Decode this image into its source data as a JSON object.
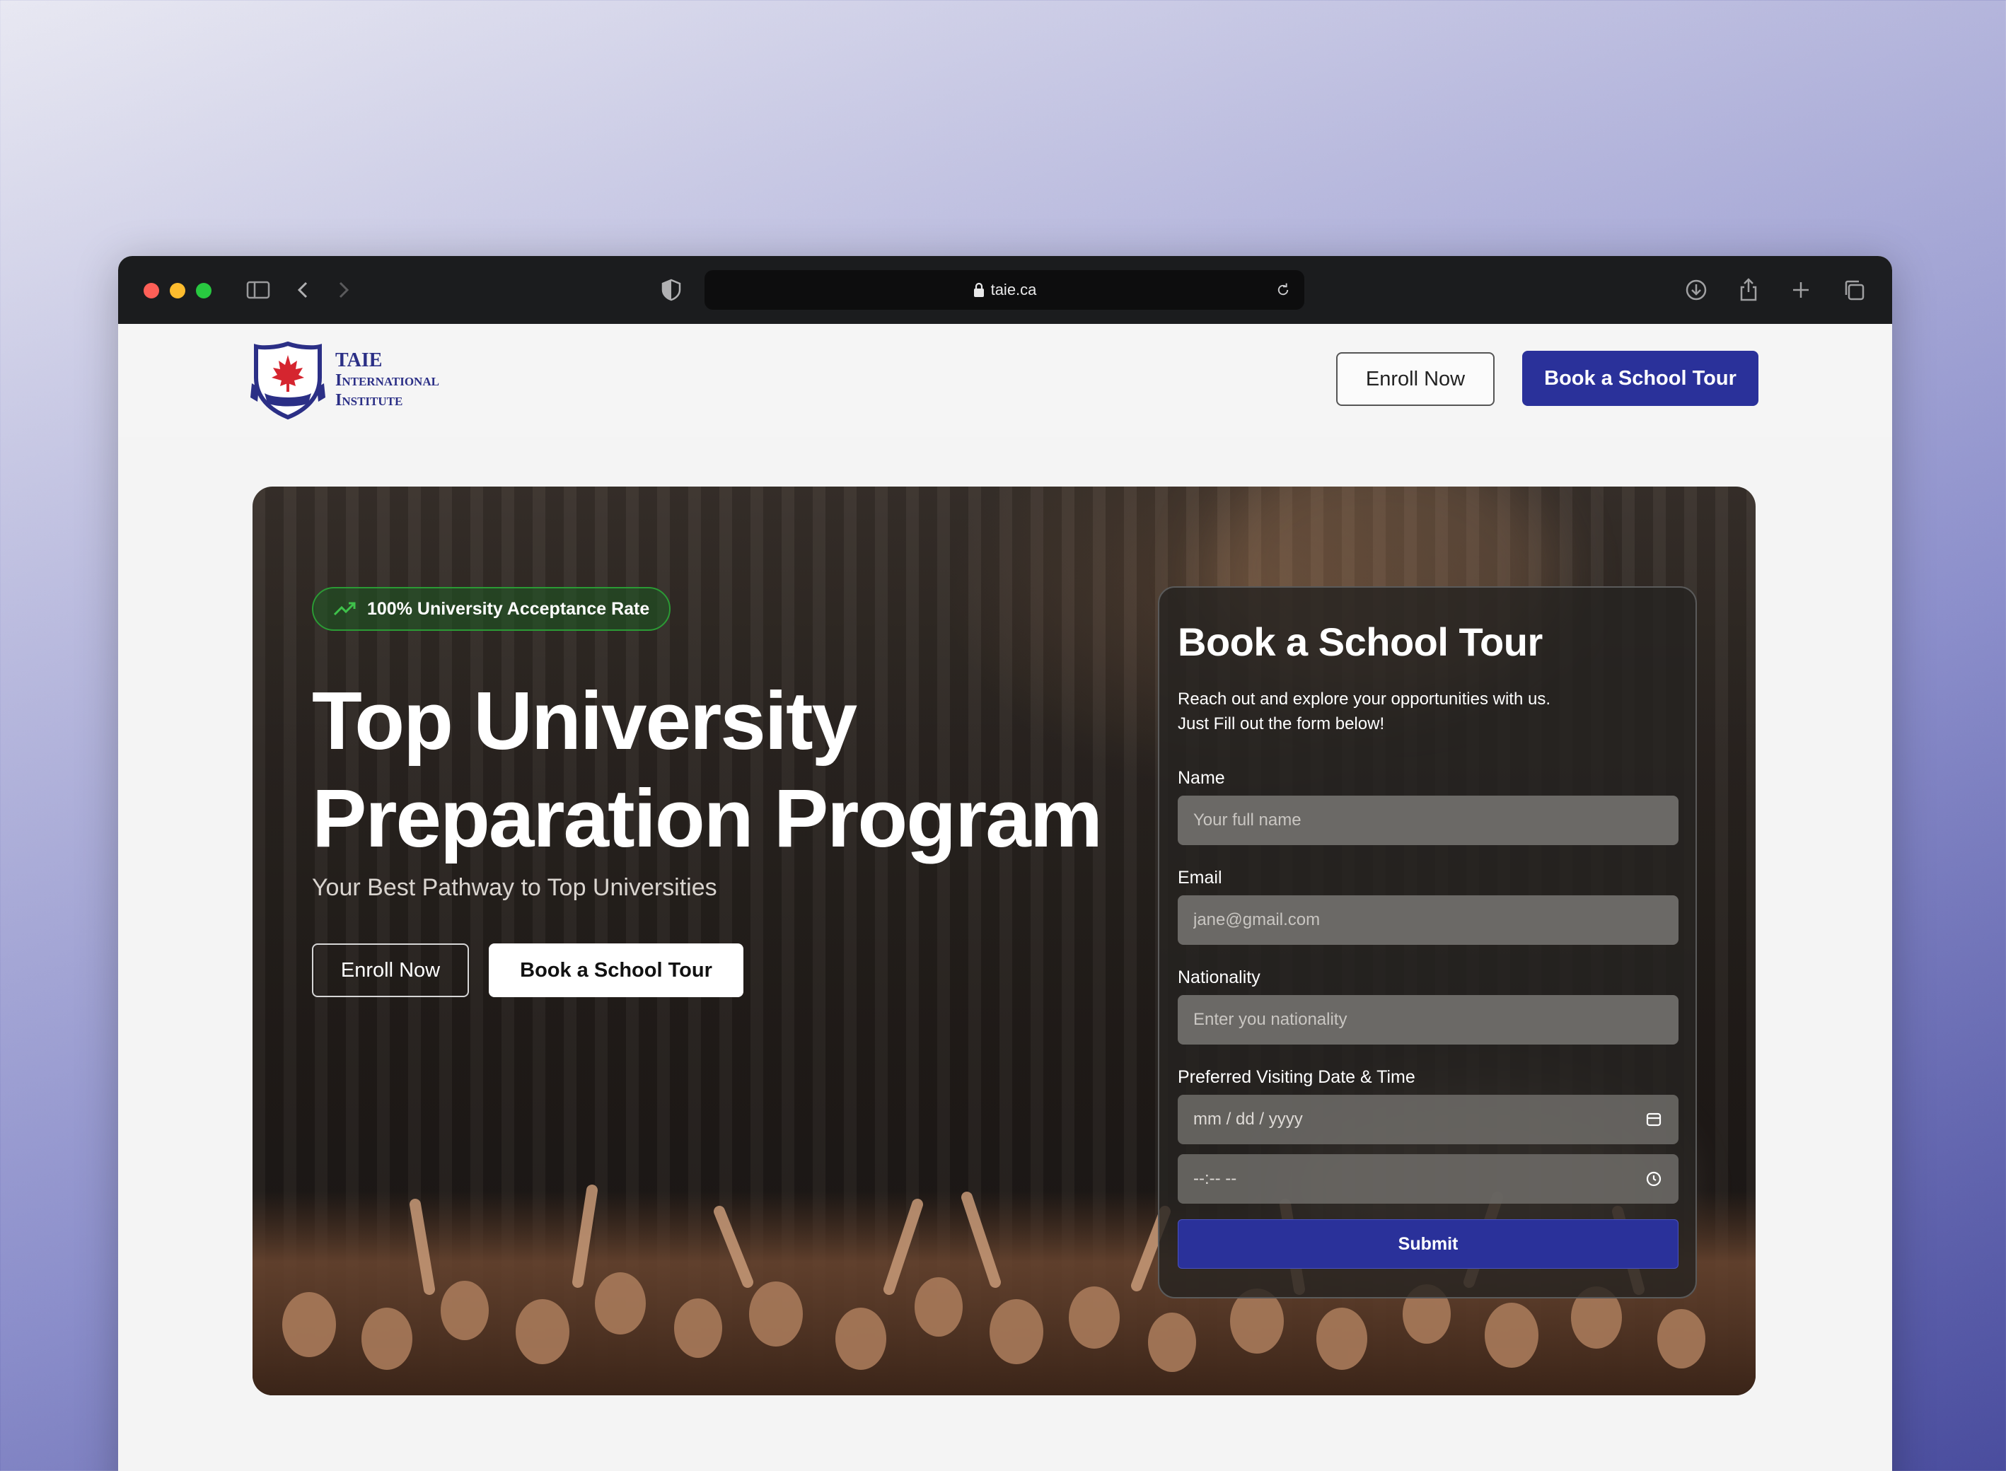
{
  "browser": {
    "url": "taie.ca"
  },
  "header": {
    "logo_line1": "TAIE",
    "logo_line2": "International",
    "logo_line3": "Institute",
    "enroll_label": "Enroll Now",
    "tour_label": "Book a School Tour"
  },
  "hero": {
    "badge": "100% University Acceptance Rate",
    "title_line1": "Top University",
    "title_line2": "Preparation Program",
    "subtitle": "Your Best Pathway to Top Universities",
    "enroll_label": "Enroll Now",
    "tour_label": "Book a School Tour"
  },
  "form": {
    "title": "Book a School Tour",
    "desc_line1": "Reach out and explore your opportunities with us.",
    "desc_line2": "Just Fill out the form below!",
    "name_label": "Name",
    "name_placeholder": "Your full name",
    "email_label": "Email",
    "email_placeholder": "jane@gmail.com",
    "nationality_label": "Nationality",
    "nationality_placeholder": "Enter you nationality",
    "datetime_label": "Preferred Visiting Date & Time",
    "date_placeholder": "mm / dd / yyyy",
    "time_placeholder": "--:-- --",
    "submit_label": "Submit"
  },
  "colors": {
    "brand": "#2a319a",
    "badge_green": "#2b9a35"
  }
}
